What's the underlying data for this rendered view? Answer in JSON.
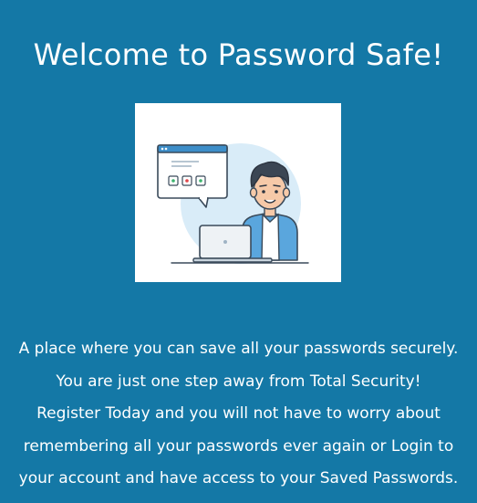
{
  "title": "Welcome to Password Safe!",
  "hero": {
    "illustration": "man-with-laptop-and-password-popup",
    "colors": {
      "accent": "#5aa6dd",
      "popup_bar": "#3d8ec9",
      "background_blob": "#d9ecf8"
    }
  },
  "description": {
    "lines": [
      "A place where you can save all your passwords securely.",
      "You are just one step away from Total Security!",
      "Register Today and you will not have to worry about",
      "remembering all your passwords ever again or Login to",
      "your account and have access to your Saved Passwords."
    ]
  },
  "colors": {
    "background": "#1478a6",
    "text": "#ffffff"
  }
}
